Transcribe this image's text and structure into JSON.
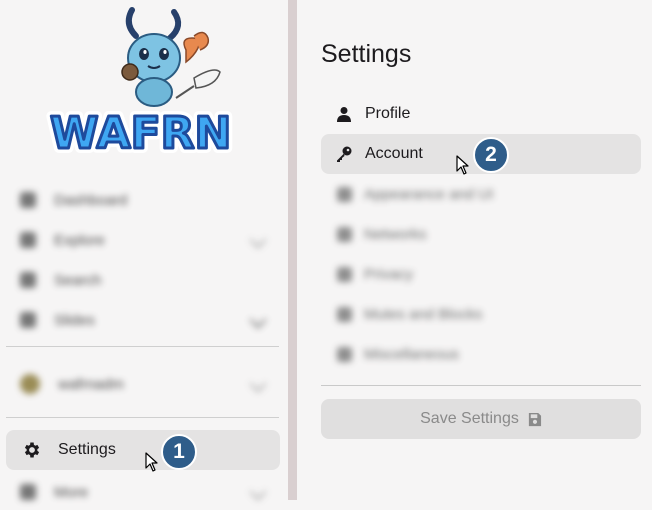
{
  "sidebar": {
    "logo_text": "WAFRN",
    "blurred_items": [
      {
        "label": "Dashboard",
        "icon": "home-icon"
      },
      {
        "label": "Explore",
        "icon": "compass-icon"
      },
      {
        "label": "Search",
        "icon": "search-icon"
      },
      {
        "label": "Slides",
        "icon": "image-icon"
      },
      {
        "label": "wafrnadm",
        "icon": "avatar"
      },
      {
        "label": "More",
        "icon": "menu-icon"
      }
    ],
    "settings_label": "Settings"
  },
  "panel": {
    "title": "Settings",
    "items": [
      {
        "label": "Profile",
        "icon": "user-icon"
      },
      {
        "label": "Account",
        "icon": "key-icon"
      },
      {
        "label": "Appearance and UI",
        "icon": "brush-icon"
      },
      {
        "label": "Networks",
        "icon": "network-icon"
      },
      {
        "label": "Privacy",
        "icon": "lock-icon"
      },
      {
        "label": "Mutes and Blocks",
        "icon": "block-icon"
      },
      {
        "label": "Miscellaneous",
        "icon": "dots-icon"
      }
    ],
    "save_label": "Save Settings"
  },
  "annotations": {
    "step1": "1",
    "step2": "2"
  },
  "colors": {
    "badge": "#2f5d8a",
    "active_bg": "#e4e3e3",
    "scroll_track": "#d9cfd0"
  }
}
